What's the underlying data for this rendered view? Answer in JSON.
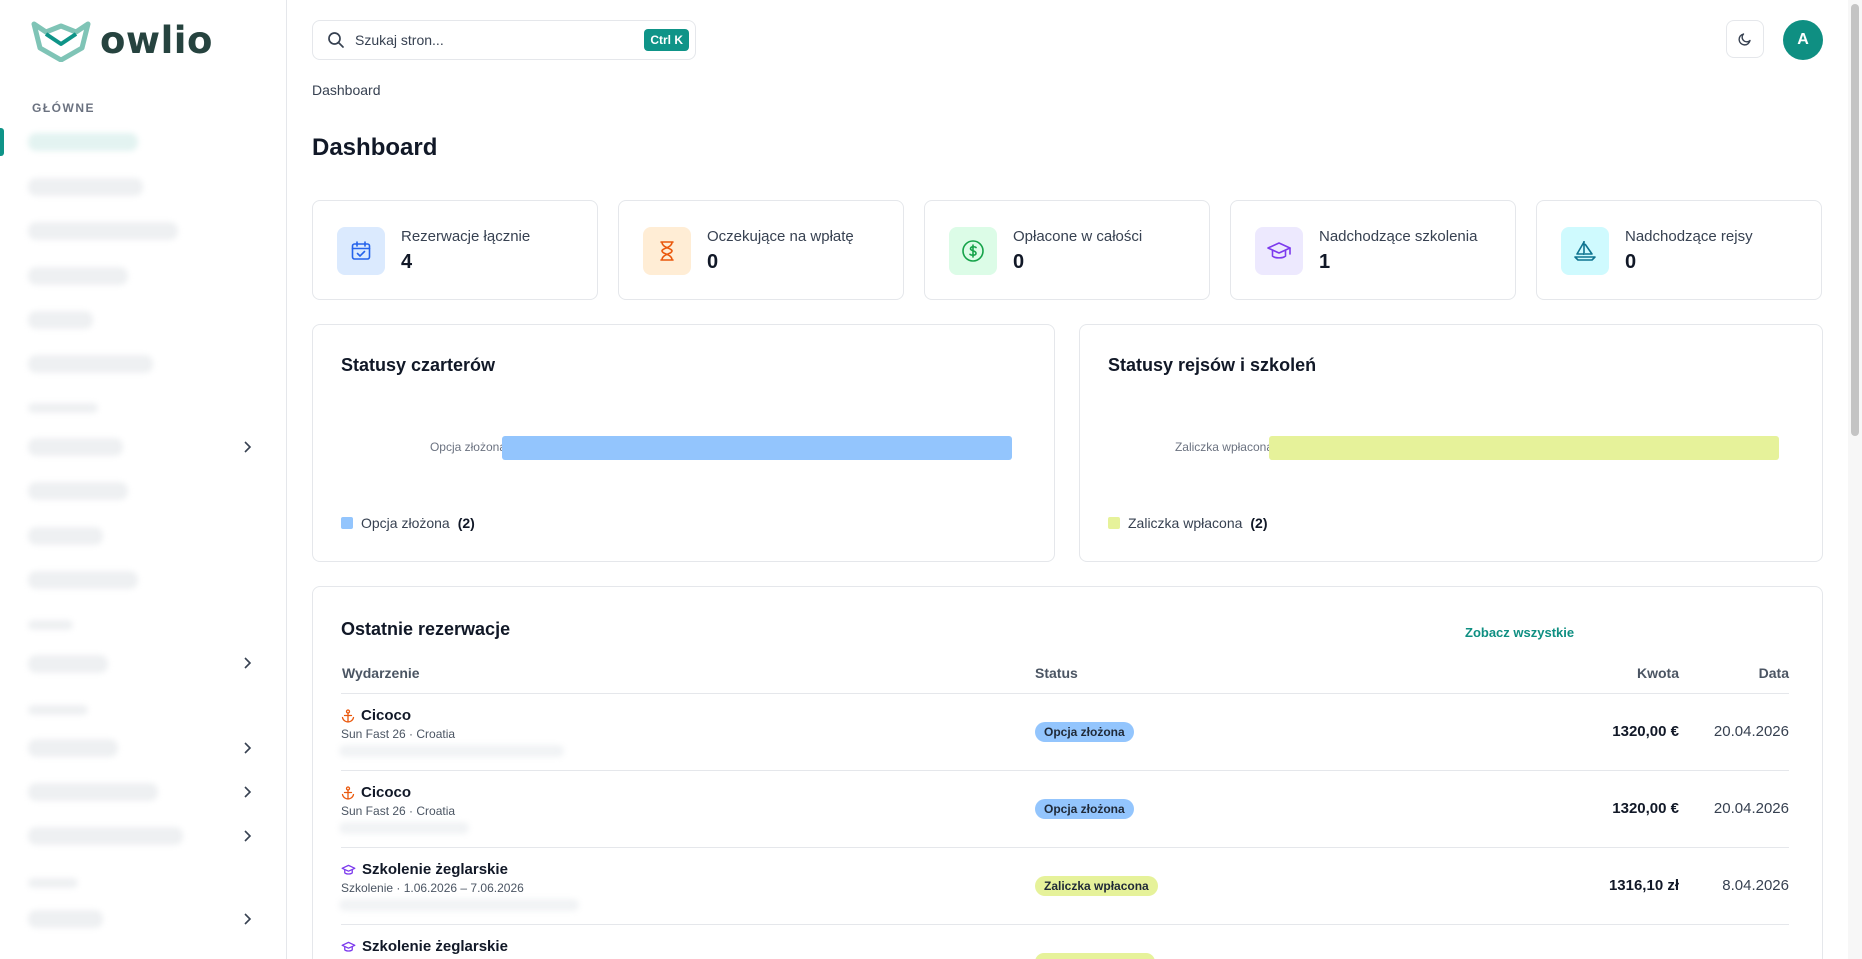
{
  "app": {
    "name": "owlio"
  },
  "sidebar": {
    "section_main": "GŁÓWNE"
  },
  "search": {
    "placeholder": "Szukaj stron...",
    "shortcut": "Ctrl K"
  },
  "user": {
    "initial": "A"
  },
  "breadcrumb": "Dashboard",
  "page_title": "Dashboard",
  "stats": [
    {
      "label": "Rezerwacje łącznie",
      "value": "4",
      "icon": "calendar-check-icon",
      "color": "#2563eb",
      "bg": "#dbeafe"
    },
    {
      "label": "Oczekujące na wpłatę",
      "value": "0",
      "icon": "hourglass-icon",
      "color": "#ea580c",
      "bg": "#ffedd5"
    },
    {
      "label": "Opłacone w całości",
      "value": "0",
      "icon": "dollar-circle-icon",
      "color": "#16a34a",
      "bg": "#dcfce7"
    },
    {
      "label": "Nadchodzące szkolenia",
      "value": "1",
      "icon": "graduation-cap-icon",
      "color": "#7c3aed",
      "bg": "#ede9fe"
    },
    {
      "label": "Nadchodzące rejsy",
      "value": "0",
      "icon": "sailboat-icon",
      "color": "#0e7490",
      "bg": "#cffafe"
    }
  ],
  "charts": {
    "charter": {
      "title": "Statusy czarterów",
      "bar_label": "Opcja złożona",
      "legend_label": "Opcja złożona",
      "legend_count": "(2)",
      "color": "#93c5fd"
    },
    "cruise": {
      "title": "Statusy rejsów i szkoleń",
      "bar_label": "Zaliczka wpłacona",
      "legend_label": "Zaliczka wpłacona",
      "legend_count": "(2)",
      "color": "#e6f29a"
    }
  },
  "chart_data": [
    {
      "type": "bar",
      "orientation": "horizontal",
      "title": "Statusy czarterów",
      "categories": [
        "Opcja złożona"
      ],
      "values": [
        2
      ]
    },
    {
      "type": "bar",
      "orientation": "horizontal",
      "title": "Statusy rejsów i szkoleń",
      "categories": [
        "Zaliczka wpłacona"
      ],
      "values": [
        2
      ]
    }
  ],
  "recent": {
    "title": "Ostatnie rezerwacje",
    "see_all": "Zobacz wszystkie",
    "columns": {
      "event": "Wydarzenie",
      "status": "Status",
      "amount": "Kwota",
      "date": "Data"
    },
    "rows": [
      {
        "icon": "anchor-icon",
        "title": "Cicoco",
        "subtitle": "Sun Fast 26 · Croatia",
        "status": "Opcja złożona",
        "status_color": "#93c5fd",
        "amount": "1320,00 €",
        "date": "20.04.2026"
      },
      {
        "icon": "anchor-icon",
        "title": "Cicoco",
        "subtitle": "Sun Fast 26 · Croatia",
        "status": "Opcja złożona",
        "status_color": "#93c5fd",
        "amount": "1320,00 €",
        "date": "20.04.2026"
      },
      {
        "icon": "graduation-cap-icon",
        "title": "Szkolenie żeglarskie",
        "subtitle": "Szkolenie · 1.06.2026 – 7.06.2026",
        "status": "Zaliczka wpłacona",
        "status_color": "#e6f29a",
        "amount": "1316,10 zł",
        "date": "8.04.2026"
      },
      {
        "icon": "graduation-cap-icon",
        "title": "Szkolenie żeglarskie",
        "subtitle": "",
        "status": "",
        "status_color": "#e6f29a",
        "amount": "",
        "date": ""
      }
    ]
  }
}
